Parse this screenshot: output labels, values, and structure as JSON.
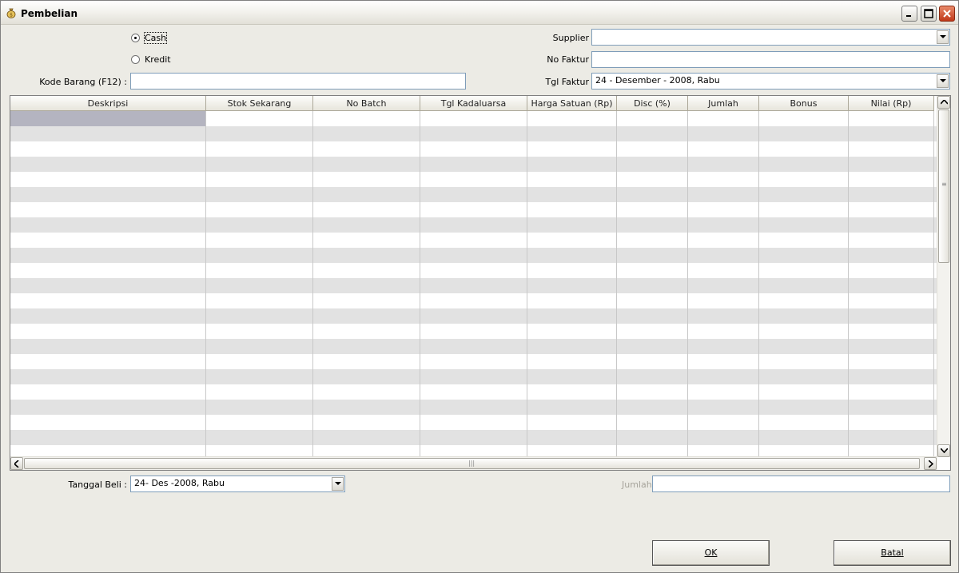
{
  "window": {
    "title": "Pembelian",
    "icon": "money-bag-icon"
  },
  "payment": {
    "cash_label": "Cash",
    "kredit_label": "Kredit",
    "selected": "Cash"
  },
  "kode_barang": {
    "label": "Kode Barang (F12) :",
    "value": ""
  },
  "supplier": {
    "label": "Supplier",
    "value": ""
  },
  "no_faktur": {
    "label": "No Faktur",
    "value": ""
  },
  "tgl_faktur": {
    "label": "Tgl Faktur",
    "value": "24 - Desember - 2008,  Rabu"
  },
  "grid": {
    "columns": [
      "Deskripsi",
      "Stok Sekarang",
      "No Batch",
      "Tgl Kadaluarsa",
      "Harga Satuan (Rp)",
      "Disc (%)",
      "Jumlah",
      "Bonus",
      "Nilai (Rp)"
    ],
    "row_colors": {
      "even": "#ffffff",
      "odd": "#e2e2e2",
      "selected": "#b4b4c0"
    }
  },
  "tanggal_beli": {
    "label": "Tanggal Beli :",
    "value": "24- Des -2008,  Rabu"
  },
  "jumlah": {
    "label": "Jumlah",
    "value": ""
  },
  "buttons": {
    "ok": "OK",
    "batal": "Batal"
  }
}
